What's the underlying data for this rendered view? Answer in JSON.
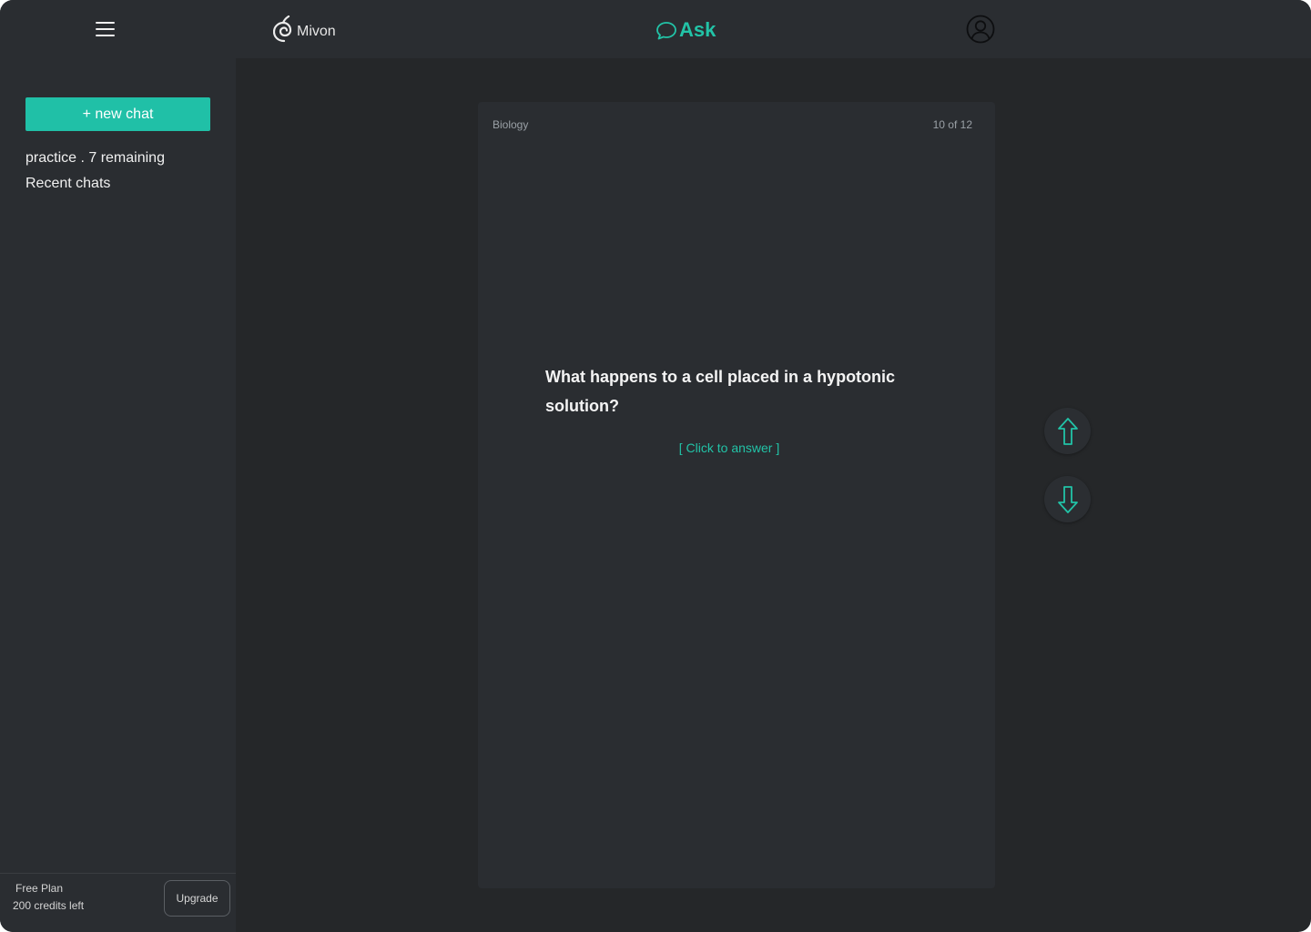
{
  "app": {
    "brand": "Mivon",
    "mode_label": "Ask"
  },
  "colors": {
    "accent": "#20c0a7",
    "background": "#252729",
    "panel": "#2a2d31"
  },
  "icons": {
    "menu": "hamburger-menu-icon",
    "logo": "spiral-logo-icon",
    "ask": "chat-bubble-icon",
    "account": "user-circle-icon",
    "previous": "arrow-up-icon",
    "next": "arrow-down-icon"
  },
  "sidebar": {
    "new_chat_label": "+ new chat",
    "practice_label": "practice . 7 remaining",
    "recent_label": "Recent chats",
    "plan": {
      "name": "Free Plan",
      "credits": "200 credits left",
      "upgrade_label": "Upgrade"
    }
  },
  "card": {
    "subject": "Biology",
    "counter": "10 of 12",
    "question": "What happens to a cell placed in a hypotonic solution?",
    "answer_prompt": "[ Click to answer ]"
  }
}
